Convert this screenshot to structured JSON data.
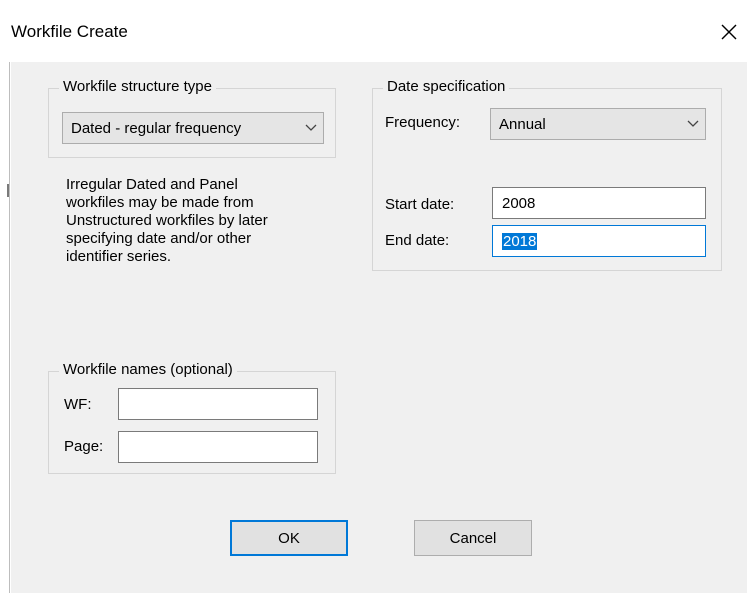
{
  "window": {
    "title": "Workfile Create",
    "close_icon": "close-icon"
  },
  "structure": {
    "group_label": "Workfile structure type",
    "selected": "Dated - regular frequency"
  },
  "info": {
    "lines": [
      "Irregular Dated and Panel",
      "workfiles may be made from",
      "Unstructured workfiles by later",
      "specifying date and/or other",
      "identifier series."
    ]
  },
  "date_spec": {
    "group_label": "Date specification",
    "frequency_label": "Frequency:",
    "frequency_value": "Annual",
    "start_label": "Start date:",
    "start_value": "2008",
    "end_label": "End date:",
    "end_value": "2018"
  },
  "names": {
    "group_label": "Workfile names (optional)",
    "wf_label": "WF:",
    "wf_value": "",
    "page_label": "Page:",
    "page_value": ""
  },
  "buttons": {
    "ok": "OK",
    "cancel": "Cancel"
  },
  "colors": {
    "selection": "#0078d7",
    "default_button_border": "#0078d7",
    "dialog_bg": "#f0f0f0"
  }
}
